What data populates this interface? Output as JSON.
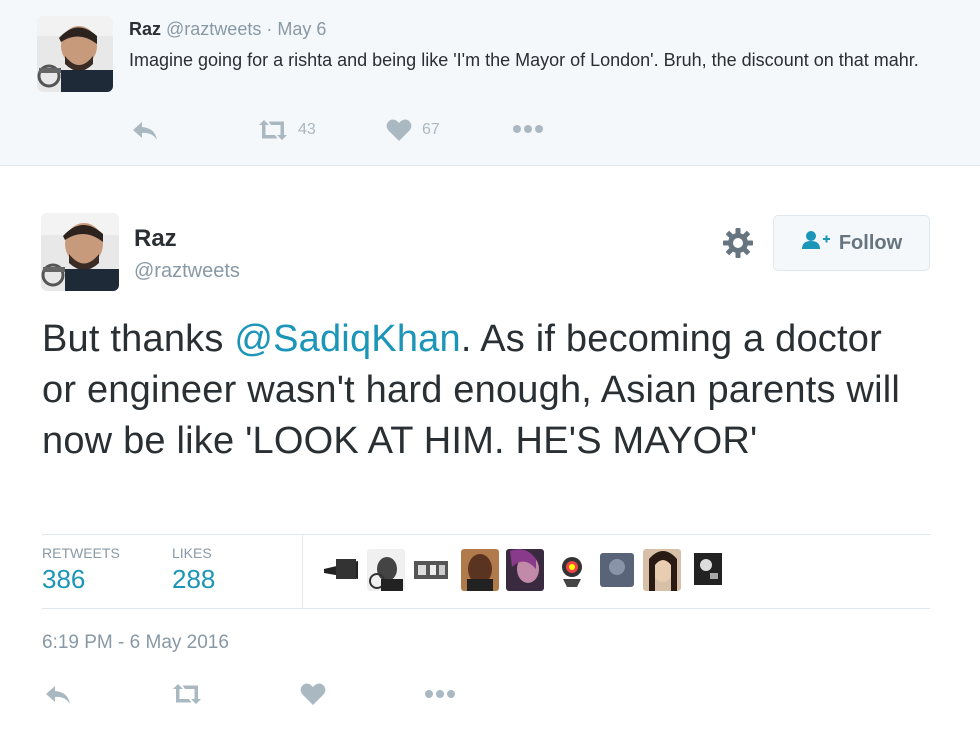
{
  "reply": {
    "name": "Raz",
    "handle": "@raztweets",
    "separator": "·",
    "date": "May 6",
    "text": "Imagine going for a rishta and being like 'I'm the Mayor of London'. Bruh, the discount on that mahr.",
    "retweet_count": "43",
    "like_count": "67"
  },
  "main": {
    "name": "Raz",
    "handle": "@raztweets",
    "follow_label": "Follow",
    "text_before": "But thanks ",
    "mention": "@SadiqKhan",
    "text_after": ". As if becoming a doctor or engineer wasn't hard enough, Asian parents will now be like 'LOOK AT HIM. HE'S MAYOR'",
    "retweets_label": "RETWEETS",
    "retweets_value": "386",
    "likes_label": "LIKES",
    "likes_value": "288",
    "timestamp": "6:19 PM - 6 May 2016"
  },
  "colors": {
    "link": "#1b95b8",
    "muted": "#8899a6",
    "icon": "#aab8c2",
    "reply_bg": "#f5f8fa"
  },
  "icons": {
    "reply": "reply-icon",
    "retweet": "retweet-icon",
    "like": "heart-icon",
    "more": "more-icon",
    "settings": "gear-icon",
    "follow": "follow-person-icon"
  }
}
